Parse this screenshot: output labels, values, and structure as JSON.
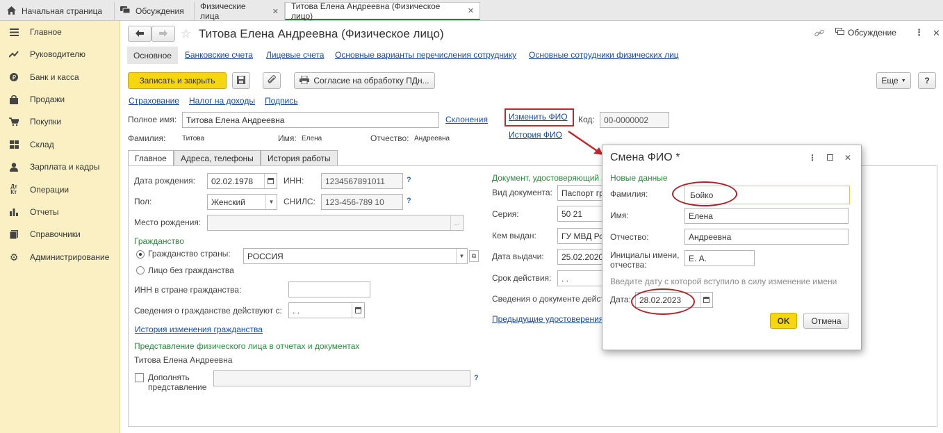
{
  "top_tabs": [
    {
      "label": "Начальная страница"
    },
    {
      "label": "Обсуждения"
    },
    {
      "label": "Физические лица"
    },
    {
      "label": "Титова Елена Андреевна (Физическое лицо)"
    }
  ],
  "sidebar": {
    "items": [
      {
        "label": "Главное",
        "icon": "menu-icon"
      },
      {
        "label": "Руководителю",
        "icon": "chart-up-icon"
      },
      {
        "label": "Банк и касса",
        "icon": "coin-icon"
      },
      {
        "label": "Продажи",
        "icon": "bag-icon"
      },
      {
        "label": "Покупки",
        "icon": "cart-icon"
      },
      {
        "label": "Склад",
        "icon": "warehouse-icon"
      },
      {
        "label": "Зарплата и кадры",
        "icon": "person-icon"
      },
      {
        "label": "Операции",
        "icon": "operations-icon"
      },
      {
        "label": "Отчеты",
        "icon": "bar-chart-icon"
      },
      {
        "label": "Справочники",
        "icon": "books-icon"
      },
      {
        "label": "Администрирование",
        "icon": "gear-icon"
      }
    ]
  },
  "header": {
    "title": "Титова Елена Андреевна (Физическое лицо)",
    "discussion": "Обсуждение"
  },
  "nav_links": [
    "Основное",
    "Банковские счета",
    "Лицевые счета",
    "Основные варианты перечисления сотруднику",
    "Основные сотрудники физических лиц"
  ],
  "toolbar": {
    "save_close": "Записать и закрыть",
    "consent": "Согласие на обработку ПДн...",
    "more": "Еще",
    "help": "?"
  },
  "sub_links": [
    "Страхование",
    "Налог на доходы",
    "Подпись"
  ],
  "person": {
    "full_name_label": "Полное имя:",
    "full_name": "Титова Елена Андреевна",
    "declensions": "Склонения",
    "change_fio": "Изменить ФИО",
    "fio_history": "История ФИО",
    "code_label": "Код:",
    "code": "00-0000002",
    "surname_label": "Фамилия:",
    "surname": "Титова",
    "name_label": "Имя:",
    "name": "Елена",
    "patronymic_label": "Отчество:",
    "patronymic": "Андреевна"
  },
  "form_tabs": [
    "Главное",
    "Адреса, телефоны",
    "История работы"
  ],
  "main_tab": {
    "birth_date_label": "Дата рождения:",
    "birth_date": "02.02.1978",
    "inn_label": "ИНН:",
    "inn": "1234567891011",
    "gender_label": "Пол:",
    "gender": "Женский",
    "snils_label": "СНИЛС:",
    "snils": "123-456-789 10",
    "birthplace_label": "Место рождения:",
    "citizenship_header": "Гражданство",
    "citizen_country_label": "Гражданство страны:",
    "country": "РОССИЯ",
    "stateless_label": "Лицо без гражданства",
    "inn_foreign_label": "ИНН в стране гражданства:",
    "citizenship_from_label": "Сведения о гражданстве действуют с:",
    "citizenship_from": " .  .",
    "citizenship_history": "История изменения гражданства",
    "representation_header": "Представление физического лица в отчетах и документах",
    "representation": "Титова Елена Андреевна",
    "supplement_label_1": "Дополнять",
    "supplement_label_2": "представление",
    "q": "?"
  },
  "document": {
    "header": "Документ, удостоверяющий л",
    "type_label": "Вид документа:",
    "type": "Паспорт гр",
    "series_label": "Серия:",
    "series": "50 21",
    "issued_by_label": "Кем выдан:",
    "issued_by": "ГУ МВД Ро",
    "issue_date_label": "Дата выдачи:",
    "issue_date": "25.02.2020",
    "validity_label": "Срок действия:",
    "validity": " .  .",
    "info_label": "Сведения о документе дейст",
    "previous": "Предыдущие удостоверения"
  },
  "dialog": {
    "title": "Смена ФИО *",
    "section": "Новые данные",
    "surname_label": "Фамилия:",
    "surname": "Бойко",
    "name_label": "Имя:",
    "name": "Елена",
    "patronymic_label": "Отчество:",
    "patronymic": "Андреевна",
    "initials_label_1": "Инициалы имени,",
    "initials_label_2": "отчества:",
    "initials": "Е. А.",
    "hint": "Введите дату с которой вступило в силу изменение имени",
    "date_label": "Дата:",
    "date": "28.02.2023",
    "ok": "OK",
    "cancel": "Отмена"
  },
  "colors": {
    "accent_yellow": "#f5d611",
    "sidebar_bg": "#fbf0c3",
    "link_blue": "#1a4a9a",
    "group_green": "#2c8a3f",
    "highlight_red": "#c1272d"
  }
}
